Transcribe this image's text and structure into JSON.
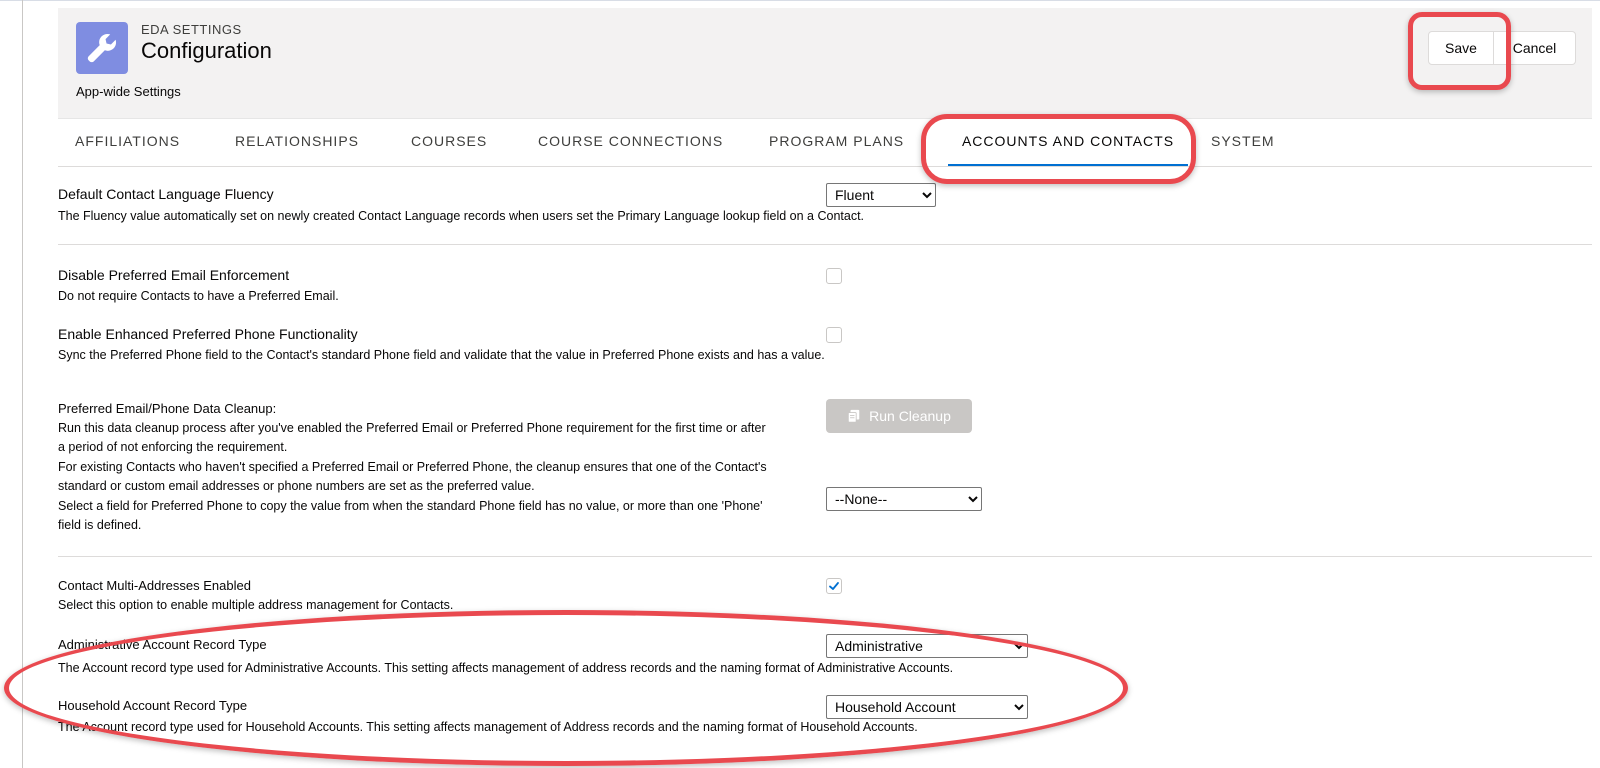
{
  "header": {
    "eyebrow": "EDA SETTINGS",
    "title": "Configuration",
    "subtitle": "App-wide Settings",
    "app_icon": "wrench-icon",
    "save_label": "Save",
    "cancel_label": "Cancel"
  },
  "tabs": [
    {
      "label": "AFFILIATIONS",
      "active": false
    },
    {
      "label": "RELATIONSHIPS",
      "active": false
    },
    {
      "label": "COURSES",
      "active": false
    },
    {
      "label": "COURSE CONNECTIONS",
      "active": false
    },
    {
      "label": "PROGRAM PLANS",
      "active": false
    },
    {
      "label": "ACCOUNTS AND CONTACTS",
      "active": true
    },
    {
      "label": "SYSTEM",
      "active": false
    }
  ],
  "settings": {
    "fluency": {
      "label": "Default Contact Language Fluency",
      "help": "The Fluency value automatically set on newly created Contact Language records when users set the Primary Language lookup field on a Contact.",
      "value": "Fluent"
    },
    "disable_email": {
      "label": "Disable Preferred Email Enforcement",
      "help": "Do not require Contacts to have a Preferred Email.",
      "checked": false
    },
    "enhanced_phone": {
      "label": "Enable Enhanced Preferred Phone Functionality",
      "help": "Sync the Preferred Phone field to the Contact's standard Phone field and validate that the value in Preferred Phone exists and has a value.",
      "checked": false
    },
    "cleanup": {
      "label": "Preferred Email/Phone Data Cleanup:",
      "help_1": "Run this data cleanup process after you've enabled the Preferred Email or Preferred Phone requirement for the first time or after a period of not enforcing the requirement.",
      "help_2": "For existing Contacts who haven't specified a Preferred Email or Preferred Phone, the cleanup ensures that one of the Contact's standard or custom email addresses or phone numbers are set as the preferred value.",
      "help_3": "Select a field for Preferred Phone to copy the value from when the standard Phone field has no value, or more than one 'Phone' field is defined.",
      "button_label": "Run Cleanup",
      "button_icon": "copy-icon",
      "phone_field_value": "--None--"
    },
    "multi_address": {
      "label": "Contact Multi-Addresses Enabled",
      "help": "Select this option to enable multiple address management for Contacts.",
      "checked": true
    },
    "admin_record_type": {
      "label": "Administrative Account Record Type",
      "help": "The Account record type used for Administrative Accounts. This setting affects management of address records and the naming format of Administrative Accounts.",
      "value": "Administrative"
    },
    "household_record_type": {
      "label": "Household Account Record Type",
      "help": "The Account record type used for Household Accounts. This setting affects management of Address records and the naming format of Household Accounts.",
      "value": "Household Account"
    }
  },
  "colors": {
    "highlight": "#e9494f",
    "app_icon_bg": "#7f8de1",
    "active_tab_underline": "#0070d2",
    "checkbox_check": "#0070d2"
  }
}
